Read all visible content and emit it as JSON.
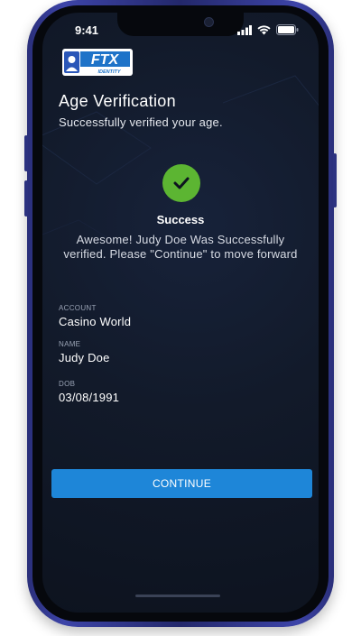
{
  "status_bar": {
    "time": "9:41"
  },
  "logo": {
    "text": "FTX",
    "subtext": "IDENTITY"
  },
  "header": {
    "title": "Age Verification",
    "subtitle": "Successfully verified your age."
  },
  "result": {
    "status": "Success",
    "message": "Awesome! Judy Doe Was Successfully verified. Please \"Continue\" to move forward"
  },
  "details": [
    {
      "label": "ACCOUNT",
      "value": "Casino World"
    },
    {
      "label": "NAME",
      "value": "Judy Doe"
    },
    {
      "label": "DOB",
      "value": "03/08/1991"
    }
  ],
  "actions": {
    "continue_label": "CONTINUE"
  },
  "colors": {
    "accent": "#1e86d8",
    "success": "#5cb532",
    "screen_bg": "#121a2a",
    "frame": "#2a2f7a"
  }
}
